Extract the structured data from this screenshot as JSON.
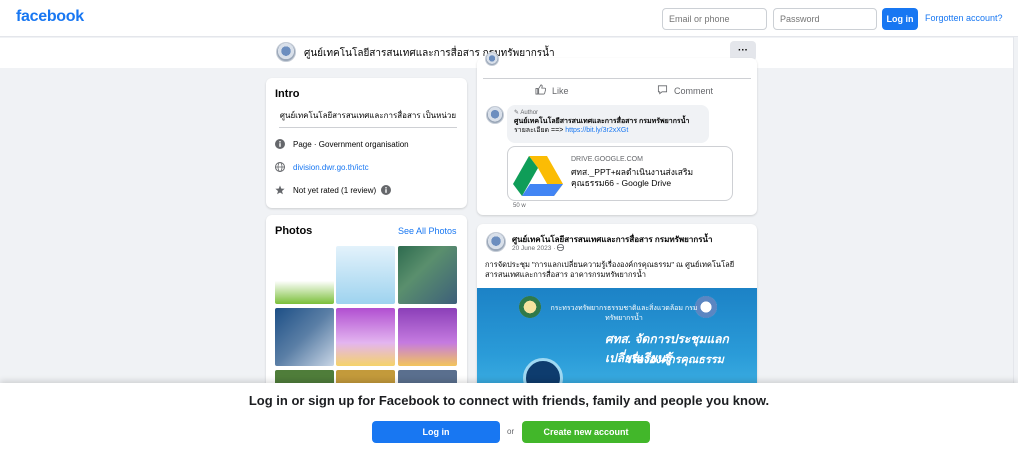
{
  "brand": {
    "logo": "facebook",
    "color": "#1877f2"
  },
  "login": {
    "email_placeholder": "Email or phone",
    "password_placeholder": "Password",
    "login_label": "Log in",
    "forgot_label": "Forgotten account?"
  },
  "page": {
    "name": "ศูนย์เทคโนโลยีสารสนเทศและการสื่อสาร กรมทรัพยากรน้ำ",
    "more_label": "···"
  },
  "intro": {
    "title": "Intro",
    "description": "ศูนย์เทคโนโลยีสารสนเทศและการสื่อสาร เป็นหน่วย",
    "items": [
      {
        "icon": "info-icon",
        "text": "Page · Government organisation"
      },
      {
        "icon": "globe-icon",
        "text": "division.dwr.go.th/ictc"
      },
      {
        "icon": "star-icon",
        "text": "Not yet rated (1 review)"
      }
    ]
  },
  "photos": {
    "title": "Photos",
    "see_all": "See All Photos"
  },
  "post1": {
    "actions": {
      "like": "Like",
      "comment": "Comment"
    },
    "comment": {
      "author_tag": "Author",
      "name": "ศูนย์เทคโนโลยีสารสนเทศและการสื่อสาร กรมทรัพยากรน้ำ",
      "text_prefix": "รายละเอียด ==> ",
      "link": "https://bit.ly/3r2xXGt",
      "time": "50 w"
    },
    "link_card": {
      "domain": "DRIVE.GOOGLE.COM",
      "title": "ศทส._PPT+ผลดำเนินงานส่งเสริมคุณธรรม66 - Google Drive"
    }
  },
  "post2": {
    "name": "ศูนย์เทคโนโลยีสารสนเทศและการสื่อสาร กรมทรัพยากรน้ำ",
    "date": "20 June 2023 · ",
    "text": "การจัดประชุม \"การแลกเปลี่ยนความรู้เรื่ององค์กรคุณธรรม\" ณ ศูนย์เทคโนโลยีสารสนเทศและการสื่อสาร อาคารกรมทรัพยากรน้ำ",
    "image": {
      "line1": "กระทรวงทรัพยากรธรรมชาติและสิ่งแวดล้อม กรมทรัพยากรน้ำ",
      "line2": "ศทส. จัดการประชุมแลกเปลี่ยนเรียนรู้",
      "line3": "เรื่ององค์กรคุณธรรม"
    }
  },
  "bottom": {
    "message": "Log in or sign up for Facebook to connect with friends, family and people you know.",
    "login_label": "Log in",
    "or": "or",
    "create_label": "Create new account"
  },
  "colors": {
    "primary": "#1877f2",
    "green": "#42b72a",
    "background": "#f0f2f5"
  }
}
